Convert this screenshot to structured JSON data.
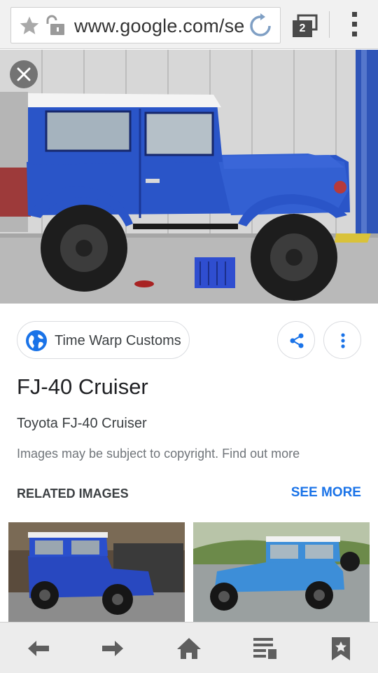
{
  "browser": {
    "url": "www.google.com/se",
    "tab_count": "2",
    "icons": [
      "star-icon",
      "lock-icon",
      "reload-icon",
      "tabs-icon",
      "overflow-menu-icon"
    ]
  },
  "image_viewer": {
    "close_icon": "close-icon",
    "source": {
      "name": "Time Warp Customs",
      "icon": "globe-icon"
    },
    "share_icon": "share-icon",
    "more_icon": "more-vert-icon",
    "title": "FJ-40 Cruiser",
    "subtitle": "Toyota FJ-40 Cruiser",
    "copyright_note": "Images may be subject to copyright. Find out more",
    "related_label": "RELATED IMAGES",
    "see_more_label": "SEE MORE"
  },
  "bottom_nav": {
    "icons": [
      "back-arrow-icon",
      "forward-arrow-icon",
      "home-icon",
      "reading-list-icon",
      "bookmark-icon"
    ]
  },
  "colors": {
    "accent": "#1a73e8",
    "jeep_blue": "#2a55c8",
    "jeep_blue_light": "#3c8fd8"
  }
}
